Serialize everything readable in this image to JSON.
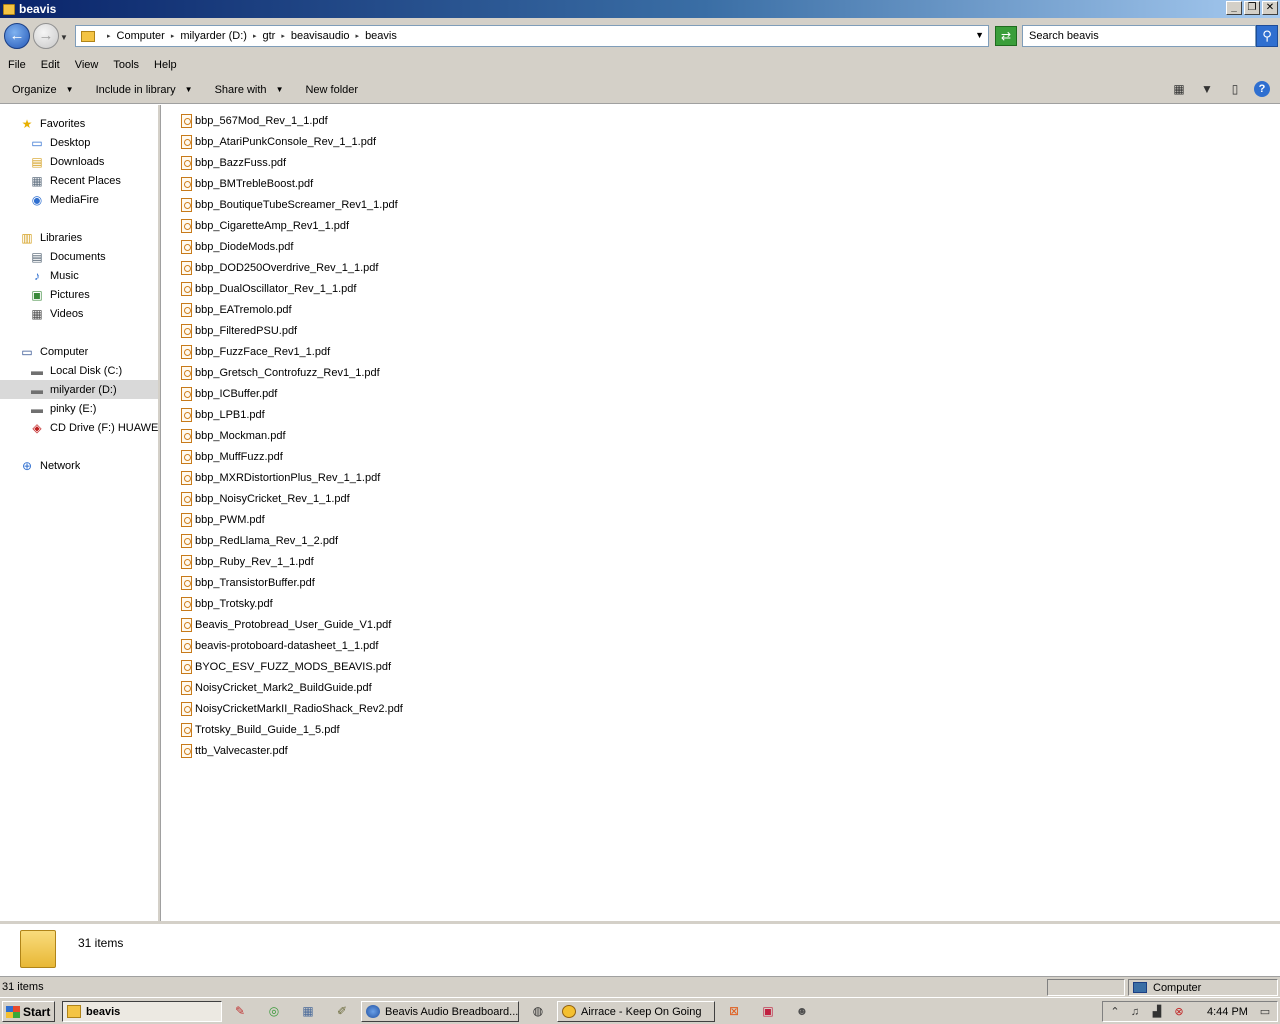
{
  "window": {
    "title": "beavis",
    "min_label": "_",
    "restore_label": "❐",
    "close_label": "✕"
  },
  "address": {
    "breadcrumbs": [
      "Computer",
      "milyarder (D:)",
      "gtr",
      "beavisaudio",
      "beavis"
    ],
    "search_placeholder": "Search beavis"
  },
  "menu": [
    "File",
    "Edit",
    "View",
    "Tools",
    "Help"
  ],
  "toolbar": {
    "organize": "Organize",
    "include": "Include in library",
    "share": "Share with",
    "new_folder": "New folder"
  },
  "nav": {
    "favorites": "Favorites",
    "desktop": "Desktop",
    "downloads": "Downloads",
    "recent": "Recent Places",
    "mediafire": "MediaFire",
    "libraries": "Libraries",
    "documents": "Documents",
    "music": "Music",
    "pictures": "Pictures",
    "videos": "Videos",
    "computer": "Computer",
    "local_disk": "Local Disk (C:)",
    "milyarder": "milyarder (D:)",
    "pinky": "pinky (E:)",
    "cd_drive": "CD Drive (F:) HUAWEI",
    "network": "Network"
  },
  "files": [
    "bbp_567Mod_Rev_1_1.pdf",
    "bbp_AtariPunkConsole_Rev_1_1.pdf",
    "bbp_BazzFuss.pdf",
    "bbp_BMTrebleBoost.pdf",
    "bbp_BoutiqueTubeScreamer_Rev1_1.pdf",
    "bbp_CigaretteAmp_Rev1_1.pdf",
    "bbp_DiodeMods.pdf",
    "bbp_DOD250Overdrive_Rev_1_1.pdf",
    "bbp_DualOscillator_Rev_1_1.pdf",
    "bbp_EATremolo.pdf",
    "bbp_FilteredPSU.pdf",
    "bbp_FuzzFace_Rev1_1.pdf",
    "bbp_Gretsch_Controfuzz_Rev1_1.pdf",
    "bbp_ICBuffer.pdf",
    "bbp_LPB1.pdf",
    "bbp_Mockman.pdf",
    "bbp_MuffFuzz.pdf",
    "bbp_MXRDistortionPlus_Rev_1_1.pdf",
    "bbp_NoisyCricket_Rev_1_1.pdf",
    "bbp_PWM.pdf",
    "bbp_RedLlama_Rev_1_2.pdf",
    "bbp_Ruby_Rev_1_1.pdf",
    "bbp_TransistorBuffer.pdf",
    "bbp_Trotsky.pdf",
    "Beavis_Protobread_User_Guide_V1.pdf",
    "beavis-protoboard-datasheet_1_1.pdf",
    "BYOC_ESV_FUZZ_MODS_BEAVIS.pdf",
    "NoisyCricket_Mark2_BuildGuide.pdf",
    "NoisyCricketMarkII_RadioShack_Rev2.pdf",
    "Trotsky_Build_Guide_1_5.pdf",
    "ttb_Valvecaster.pdf"
  ],
  "details": {
    "count": "31 items"
  },
  "status": {
    "left": "31 items",
    "right": "Computer"
  },
  "taskbar": {
    "start": "Start",
    "task_explorer": "beavis",
    "task_browser": "Beavis Audio Breadboard...",
    "task_player": "Airrace - Keep On Going",
    "clock": "4:44 PM"
  },
  "colors": {
    "titlebar_start": "#0a246a",
    "titlebar_end": "#a6caf0",
    "chrome": "#d4d0c8",
    "selected_nav": "#d9d9d9"
  }
}
